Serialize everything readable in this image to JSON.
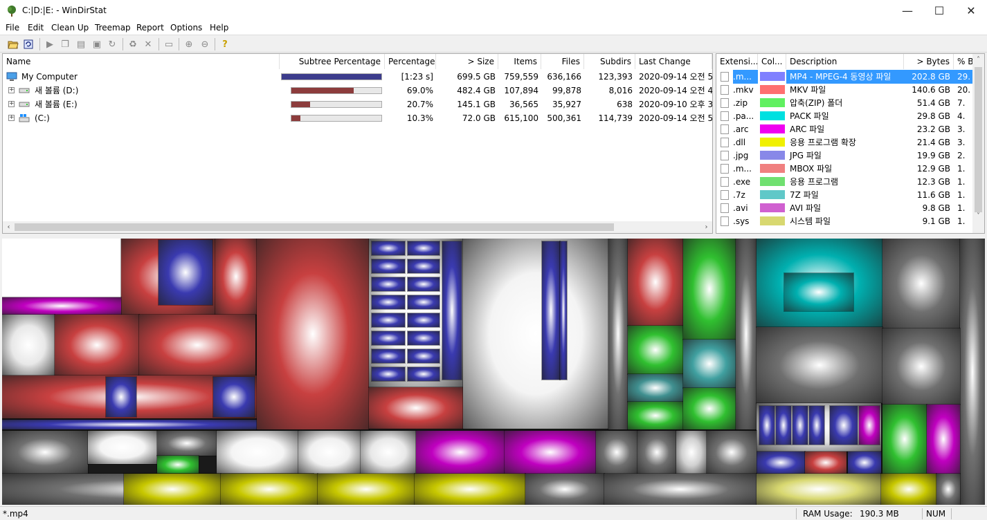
{
  "window": {
    "title": "C:|D:|E: - WinDirStat",
    "minimize": "—",
    "maximize": "☐",
    "close": "✕"
  },
  "menu": [
    "File",
    "Edit",
    "Clean Up",
    "Treemap",
    "Report",
    "Options",
    "Help"
  ],
  "toolbar": [
    "open-icon",
    "refresh-icon",
    "play-icon",
    "copy-icon",
    "explorer-icon",
    "cmd-icon",
    "refresh-selected-icon",
    "recycle-icon",
    "delete-icon",
    "new-folder-icon",
    "zoom-in-icon",
    "zoom-out-icon",
    "help-icon"
  ],
  "dir_columns": [
    "Name",
    "Subtree Percentage",
    "Percentage",
    "> Size",
    "Items",
    "Files",
    "Subdirs",
    "Last Change"
  ],
  "dir_rows": [
    {
      "name": "My Computer",
      "bar": 1.0,
      "bar_color": "#3c3c8c",
      "percentage": "[1:23 s]",
      "size": "699.5 GB",
      "items": "759,559",
      "files": "636,166",
      "subdirs": "123,393",
      "last_change": "2020-09-14  오전 5",
      "expander": ""
    },
    {
      "name": "새 볼륨 (D:)",
      "bar": 0.69,
      "bar_color": "#8c3c3c",
      "percentage": "69.0%",
      "size": "482.4 GB",
      "items": "107,894",
      "files": "99,878",
      "subdirs": "8,016",
      "last_change": "2020-09-14  오전 4",
      "expander": "+"
    },
    {
      "name": "새 볼륨 (E:)",
      "bar": 0.207,
      "bar_color": "#8c3c3c",
      "percentage": "20.7%",
      "size": "145.1 GB",
      "items": "36,565",
      "files": "35,927",
      "subdirs": "638",
      "last_change": "2020-09-10  오후 3",
      "expander": "+"
    },
    {
      "name": " (C:)",
      "bar": 0.103,
      "bar_color": "#8c3c3c",
      "percentage": "10.3%",
      "size": "72.0 GB",
      "items": "615,100",
      "files": "500,361",
      "subdirs": "114,739",
      "last_change": "2020-09-14  오전 5",
      "expander": "+"
    }
  ],
  "ext_columns": [
    "Extensi...",
    "Col...",
    "Description",
    "> Bytes",
    "% B"
  ],
  "ext_rows": [
    {
      "ext": ".m...",
      "color": "#8080ff",
      "desc": "MP4 - MPEG-4 동영상 파일",
      "bytes": "202.8 GB",
      "pct": "29.",
      "selected": true
    },
    {
      "ext": ".mkv",
      "color": "#ff7070",
      "desc": "MKV 파일",
      "bytes": "140.6 GB",
      "pct": "20.",
      "selected": false
    },
    {
      "ext": ".zip",
      "color": "#60f060",
      "desc": "압축(ZIP) 폴더",
      "bytes": "51.4 GB",
      "pct": "7.",
      "selected": false
    },
    {
      "ext": ".pa...",
      "color": "#00e0e0",
      "desc": "PACK 파일",
      "bytes": "29.8 GB",
      "pct": "4.",
      "selected": false
    },
    {
      "ext": ".arc",
      "color": "#f000f0",
      "desc": "ARC 파일",
      "bytes": "23.2 GB",
      "pct": "3.",
      "selected": false
    },
    {
      "ext": ".dll",
      "color": "#f0f000",
      "desc": "응용 프로그램 확장",
      "bytes": "21.4 GB",
      "pct": "3.",
      "selected": false
    },
    {
      "ext": ".jpg",
      "color": "#8888e8",
      "desc": "JPG 파일",
      "bytes": "19.9 GB",
      "pct": "2.",
      "selected": false
    },
    {
      "ext": ".m...",
      "color": "#f08080",
      "desc": "MBOX 파일",
      "bytes": "12.9 GB",
      "pct": "1.",
      "selected": false
    },
    {
      "ext": ".exe",
      "color": "#70e070",
      "desc": "응용 프로그램",
      "bytes": "12.3 GB",
      "pct": "1.",
      "selected": false
    },
    {
      "ext": ".7z",
      "color": "#60c8c8",
      "desc": "7Z 파일",
      "bytes": "11.6 GB",
      "pct": "1.",
      "selected": false
    },
    {
      "ext": ".avi",
      "color": "#d060d0",
      "desc": "AVI 파일",
      "bytes": "9.8 GB",
      "pct": "1.",
      "selected": false
    },
    {
      "ext": ".sys",
      "color": "#d8d870",
      "desc": "시스템 파일",
      "bytes": "9.1 GB",
      "pct": "1.",
      "selected": false
    }
  ],
  "status": {
    "left": "*.mp4",
    "ram_label": "RAM Usage:",
    "ram_value": "190.3 MB",
    "num": "NUM"
  },
  "colors": {
    "selection": "#3399ff",
    "treemap_red": "#c84040",
    "treemap_blue": "#3a3ab0",
    "treemap_green": "#30c030",
    "treemap_cyan": "#00b0b0",
    "treemap_magenta": "#c000c0",
    "treemap_yellow": "#c8c800",
    "treemap_gray": "#707070"
  }
}
